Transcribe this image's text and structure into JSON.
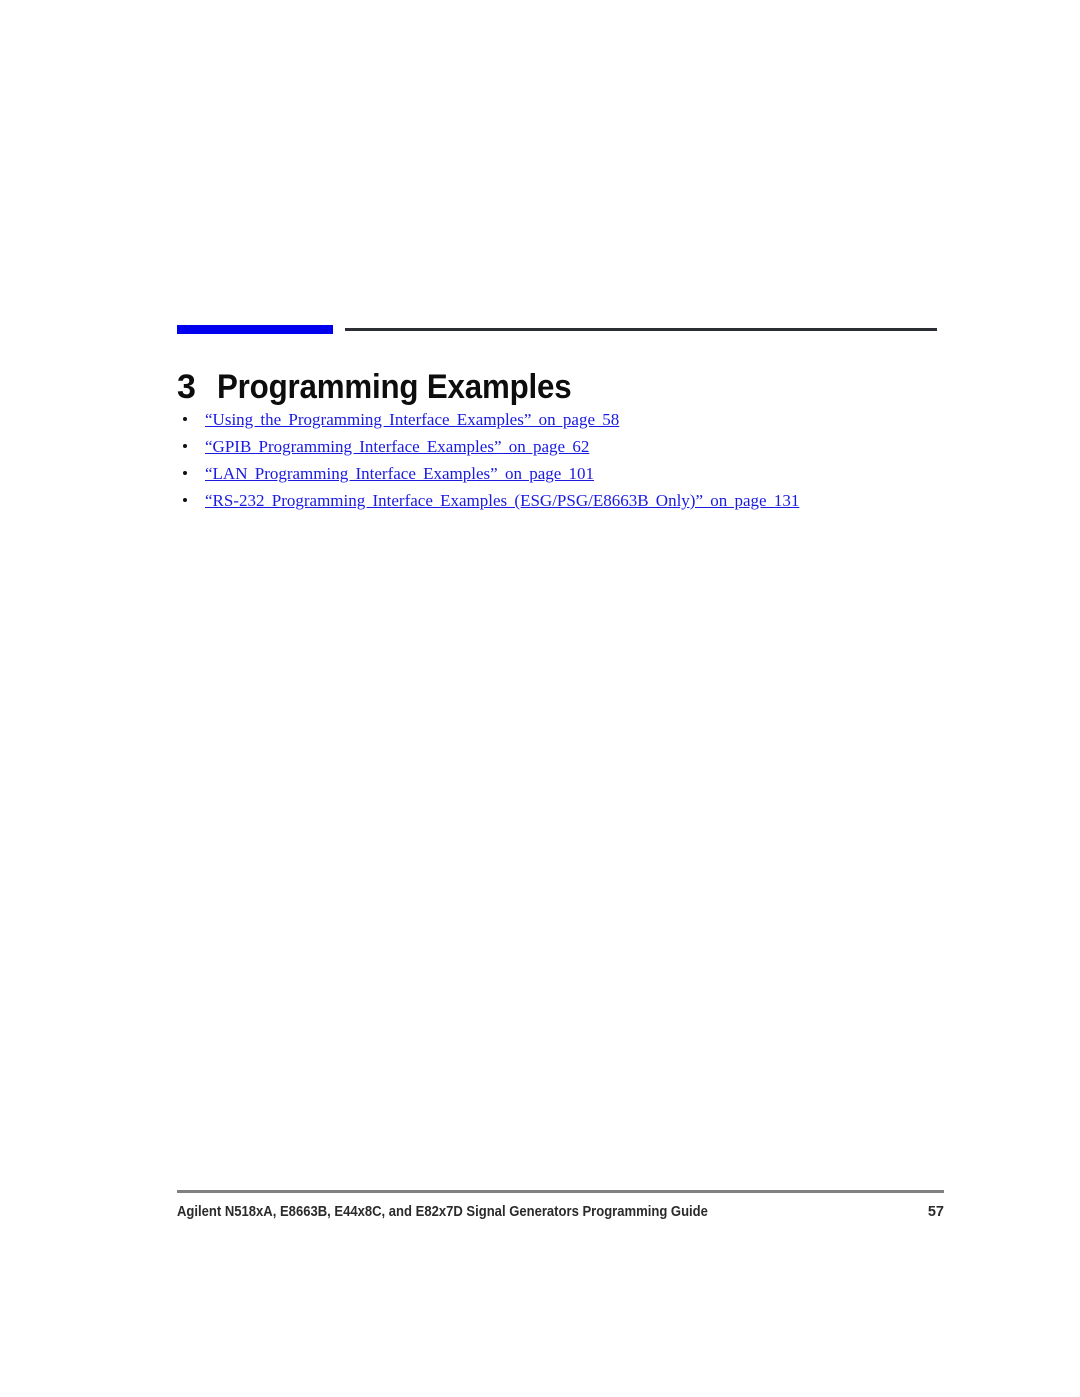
{
  "document": {
    "page_number": "57",
    "footer_text": "Agilent N518xA, E8663B, E44x8C, and E82x7D Signal Generators Programming Guide"
  },
  "chapter": {
    "number": "3",
    "title": "Programming Examples"
  },
  "colors": {
    "accent_bar": "#0000ee",
    "header_rule": "#2b2f33",
    "link": "#1a1ae0",
    "footer_rule": "#808080"
  },
  "cross_references": [
    {
      "label": "“Using the Programming Interface Examples” on page 58"
    },
    {
      "label": "“GPIB Programming Interface Examples” on page 62"
    },
    {
      "label": "“LAN Programming Interface Examples” on page 101"
    },
    {
      "label": "“RS-232 Programming Interface Examples (ESG/PSG/E8663B Only)” on page 131"
    }
  ]
}
